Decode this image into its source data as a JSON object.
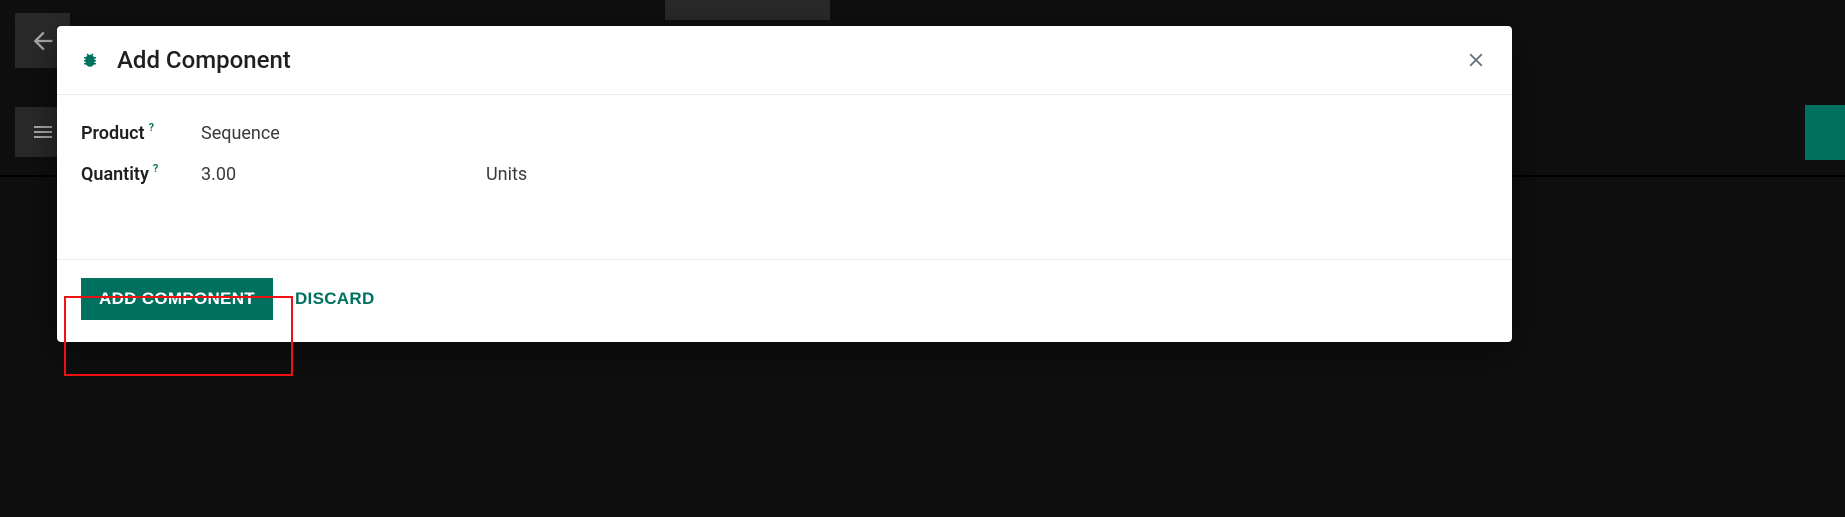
{
  "modal": {
    "title": "Add Component",
    "fields": {
      "product": {
        "label": "Product",
        "value": "Sequence",
        "help": "?"
      },
      "quantity": {
        "label": "Quantity",
        "value": "3.00",
        "unit": "Units",
        "help": "?"
      }
    },
    "buttons": {
      "primary": "Add Component",
      "discard": "Discard"
    }
  }
}
